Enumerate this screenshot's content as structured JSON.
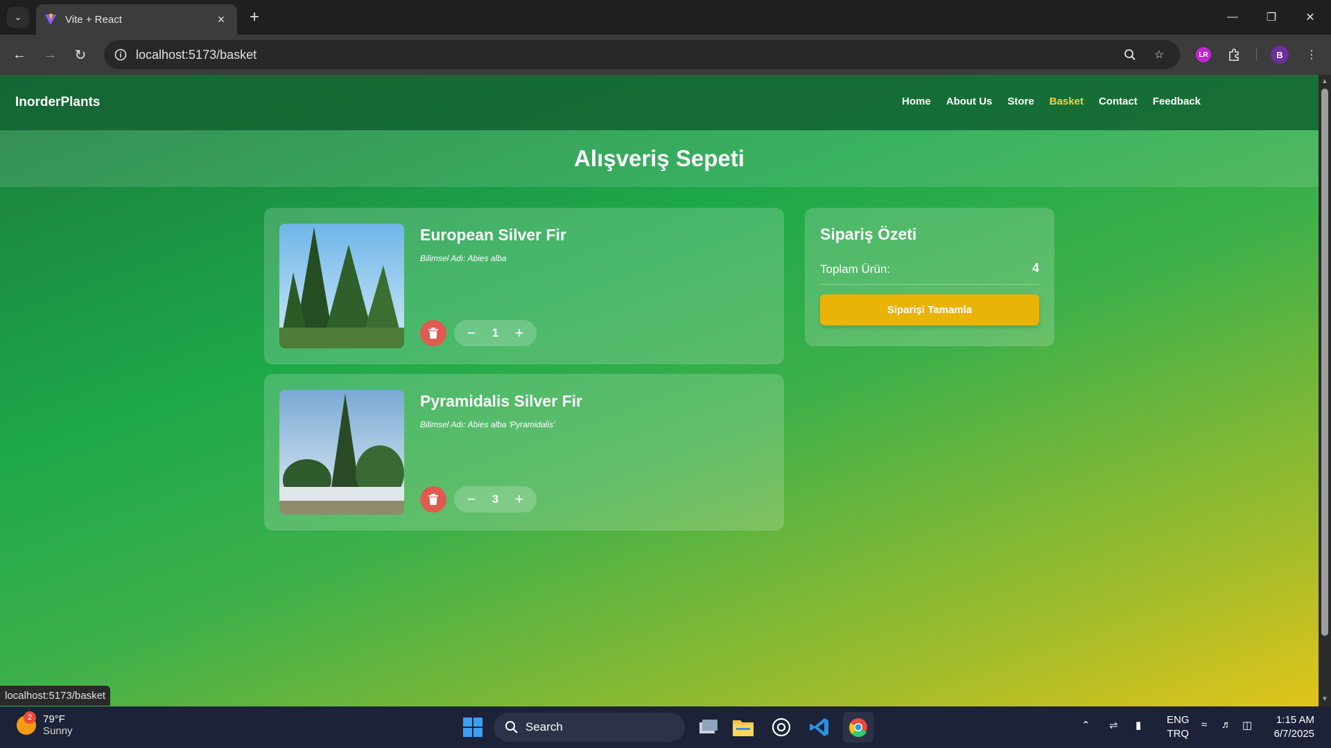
{
  "browser": {
    "tab_title": "Vite + React",
    "url": "localhost:5173/basket",
    "profile_initial": "B",
    "status_url": "localhost:5173/basket"
  },
  "site": {
    "brand": "InorderPlants",
    "nav": [
      {
        "label": "Home",
        "active": false
      },
      {
        "label": "About Us",
        "active": false
      },
      {
        "label": "Store",
        "active": false
      },
      {
        "label": "Basket",
        "active": true
      },
      {
        "label": "Contact",
        "active": false
      },
      {
        "label": "Feedback",
        "active": false
      }
    ],
    "accent_color": "#f6d33b"
  },
  "page": {
    "title": "Alışveriş Sepeti"
  },
  "cart": {
    "items": [
      {
        "name": "European Silver Fir",
        "scientific": "Bilimsel Adı: Abies alba",
        "quantity": "1"
      },
      {
        "name": "Pyramidalis Silver Fir",
        "scientific": "Bilimsel Adı: Abies alba 'Pyramidalis'",
        "quantity": "3"
      }
    ],
    "delete_color": "#e05a4f",
    "minus_symbol": "−",
    "plus_symbol": "+"
  },
  "summary": {
    "title": "Sipariş Özeti",
    "total_label": "Toplam Ürün:",
    "total_value": "4",
    "checkout_label": "Siparişi Tamamla",
    "checkout_color": "#eab308"
  },
  "taskbar": {
    "weather_temp": "79°F",
    "weather_condition": "Sunny",
    "weather_badge": "2",
    "search_label": "Search",
    "lang_primary": "ENG",
    "lang_secondary": "TRQ",
    "time": "1:15 AM",
    "date": "6/7/2025"
  }
}
